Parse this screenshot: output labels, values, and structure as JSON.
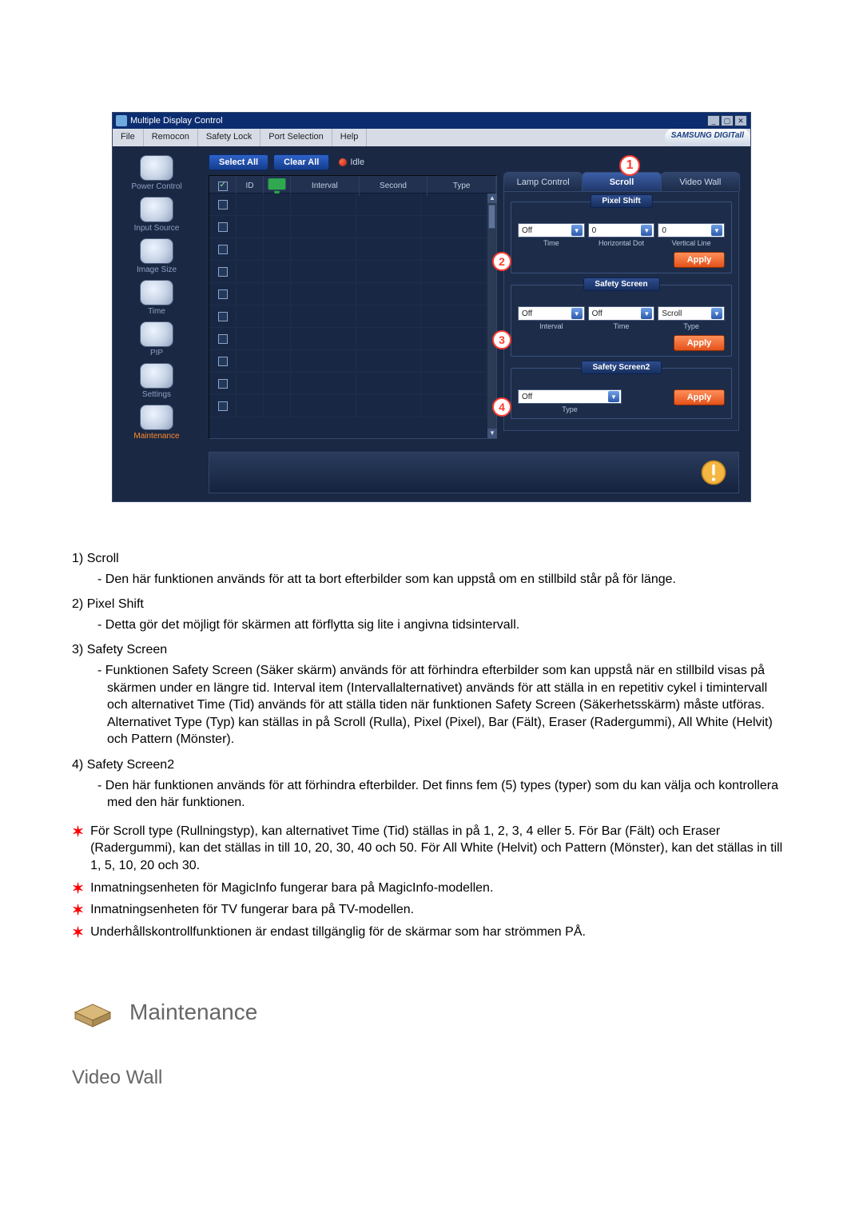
{
  "window": {
    "title": "Multiple Display Control",
    "minimize": "_",
    "maximize": "▢",
    "close": "✕"
  },
  "menu": {
    "file": "File",
    "remocon": "Remocon",
    "safety_lock": "Safety Lock",
    "port_selection": "Port Selection",
    "help": "Help",
    "brand": "SAMSUNG DIGITall"
  },
  "sidebar": {
    "items": [
      {
        "label": "Power Control"
      },
      {
        "label": "Input Source"
      },
      {
        "label": "Image Size"
      },
      {
        "label": "Time"
      },
      {
        "label": "PIP"
      },
      {
        "label": "Settings"
      },
      {
        "label": "Maintenance"
      }
    ]
  },
  "toolbar": {
    "select_all": "Select All",
    "clear_all": "Clear All",
    "idle": "Idle"
  },
  "grid": {
    "headers": {
      "chk": "☑",
      "id": "ID",
      "icon": "",
      "interval": "Interval",
      "second": "Second",
      "type": "Type"
    },
    "rows": 10
  },
  "tabs": {
    "lamp": "Lamp Control",
    "scroll": "Scroll",
    "video_wall": "Video Wall",
    "badge": "1"
  },
  "pixel_shift": {
    "legend": "Pixel Shift",
    "time_val": "Off",
    "time_lbl": "Time",
    "hdot_val": "0",
    "hdot_lbl": "Horizontal Dot",
    "vline_val": "0",
    "vline_lbl": "Vertical Line",
    "apply": "Apply",
    "badge": "2"
  },
  "safety_screen": {
    "legend": "Safety Screen",
    "interval_val": "Off",
    "interval_lbl": "Interval",
    "time_val": "Off",
    "time_lbl": "Time",
    "type_val": "Scroll",
    "type_lbl": "Type",
    "apply": "Apply",
    "badge": "3"
  },
  "safety_screen2": {
    "legend": "Safety Screen2",
    "type_val": "Off",
    "type_lbl": "Type",
    "apply": "Apply",
    "badge": "4"
  },
  "doc": {
    "item1_num": "1)",
    "item1_title": "Scroll",
    "item1_desc": "- Den här funktionen används för att ta bort efterbilder som kan uppstå om en stillbild står på för länge.",
    "item2_num": "2)",
    "item2_title": "Pixel Shift",
    "item2_desc": "- Detta gör det möjligt för skärmen att förflytta sig lite i angivna tidsintervall.",
    "item3_num": "3)",
    "item3_title": "Safety Screen",
    "item3_desc_a": "- Funktionen Safety Screen (Säker skärm) används för att förhindra efterbilder som kan uppstå när en stillbild visas på skärmen under en längre tid.  Interval item (Intervallalternativet) används för att ställa in en repetitiv cykel i timintervall och alternativet Time (Tid) används för att ställa tiden när funktionen Safety Screen (Säkerhetsskärm) måste utföras.",
    "item3_desc_b": "Alternativet Type (Typ) kan ställas in på Scroll (Rulla), Pixel (Pixel), Bar (Fält), Eraser (Radergummi), All White (Helvit) och Pattern (Mönster).",
    "item4_num": "4)",
    "item4_title": "Safety Screen2",
    "item4_desc": "- Den här funktionen används för att förhindra efterbilder. Det finns fem (5) types (typer) som du kan välja och kontrollera med den här funktionen.",
    "star1": "För Scroll type (Rullningstyp), kan alternativet Time (Tid) ställas in på 1, 2, 3, 4 eller 5. För Bar (Fält) och Eraser (Radergummi), kan det ställas in till 10, 20, 30, 40 och 50. För All White (Helvit) och Pattern (Mönster), kan det ställas in till 1, 5, 10, 20 och 30.",
    "star2": "Inmatningsenheten för MagicInfo fungerar bara på MagicInfo-modellen.",
    "star3": "Inmatningsenheten för TV fungerar bara på TV-modellen.",
    "star4": "Underhållskontrollfunktionen är endast tillgänglig för de skärmar som har strömmen PÅ.",
    "section_title": "Maintenance",
    "subsection_title": "Video Wall"
  }
}
